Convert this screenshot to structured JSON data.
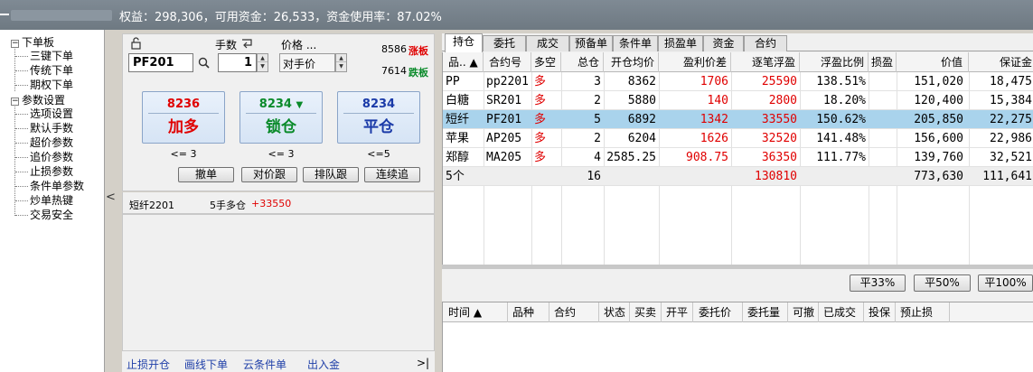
{
  "status_bar": {
    "text": "权益：298,306，可用资金：26,533，资金使用率：87.02%"
  },
  "tree": {
    "groups": [
      {
        "label": "下单板",
        "expand": "−",
        "items": [
          "三键下单",
          "传统下单",
          "期权下单"
        ]
      },
      {
        "label": "参数设置",
        "expand": "−",
        "items": [
          "选项设置",
          "默认手数",
          "超价参数",
          "追价参数",
          "止损参数",
          "条件单参数",
          "炒单热键",
          "交易安全"
        ]
      }
    ]
  },
  "order_panel": {
    "lock_icon": "unlock-icon",
    "qty_label": "手数",
    "price_label": "价格 ...",
    "code_value": "PF201",
    "qty_value": "1",
    "price_value": "对手价",
    "limit_up_price": "8586",
    "limit_up_label": "涨板",
    "limit_down_price": "7614",
    "limit_down_label": "跌板",
    "buttons": [
      {
        "price": "8236",
        "label": "加多",
        "color": "#e00000",
        "limit": "<= 3"
      },
      {
        "price": "8234",
        "arrow": "▼",
        "label": "锁仓",
        "color": "#0a8a2a",
        "limit": "<= 3"
      },
      {
        "price": "8234",
        "label": "平仓",
        "color": "#1a3aa8",
        "limit": "<=5"
      }
    ],
    "small_buttons": [
      "撤单",
      "对价跟",
      "排队跟",
      "连续追"
    ]
  },
  "info_line": {
    "name": "短纤2201",
    "position": "5手多仓",
    "pnl": "+33550"
  },
  "bottom_links": [
    "止损开仓",
    "画线下单",
    "云条件单",
    "出入金"
  ],
  "bottom_right_icon": ">|",
  "collapse_arrow": "<",
  "tabs": [
    "持仓",
    "委托",
    "成交",
    "预备单",
    "条件单",
    "损盈单",
    "资金",
    "合约"
  ],
  "positions": {
    "headers": [
      "品.. ▲",
      "合约号",
      "多空",
      "总仓",
      "开仓均价",
      "盈利价差",
      "逐笔浮盈",
      "浮盈比例",
      "损盈",
      "价值",
      "保证金"
    ],
    "rows": [
      [
        "PP",
        "pp2201",
        "多",
        "3",
        "8362",
        "1706",
        "25590",
        "138.51%",
        "",
        "151,020",
        "18,475"
      ],
      [
        "白糖",
        "SR201",
        "多",
        "2",
        "5880",
        "140",
        "2800",
        "18.20%",
        "",
        "120,400",
        "15,384"
      ],
      [
        "短纤",
        "PF201",
        "多",
        "5",
        "6892",
        "1342",
        "33550",
        "150.62%",
        "",
        "205,850",
        "22,275"
      ],
      [
        "苹果",
        "AP205",
        "多",
        "2",
        "6204",
        "1626",
        "32520",
        "141.48%",
        "",
        "156,600",
        "22,986"
      ],
      [
        "郑醇",
        "MA205",
        "多",
        "4",
        "2585.25",
        "908.75",
        "36350",
        "111.77%",
        "",
        "139,760",
        "32,521"
      ]
    ],
    "total": [
      "5个",
      "",
      "",
      "16",
      "",
      "",
      "130810",
      "",
      "",
      "773,630",
      "111,641"
    ]
  },
  "close_buttons": [
    "平33%",
    "平50%",
    "平100%"
  ],
  "orders": {
    "headers": [
      "时间 ▲",
      "品种",
      "合约",
      "状态",
      "买卖",
      "开平",
      "委托价",
      "委托量",
      "可撤",
      "已成交",
      "投保",
      "预止损"
    ]
  }
}
